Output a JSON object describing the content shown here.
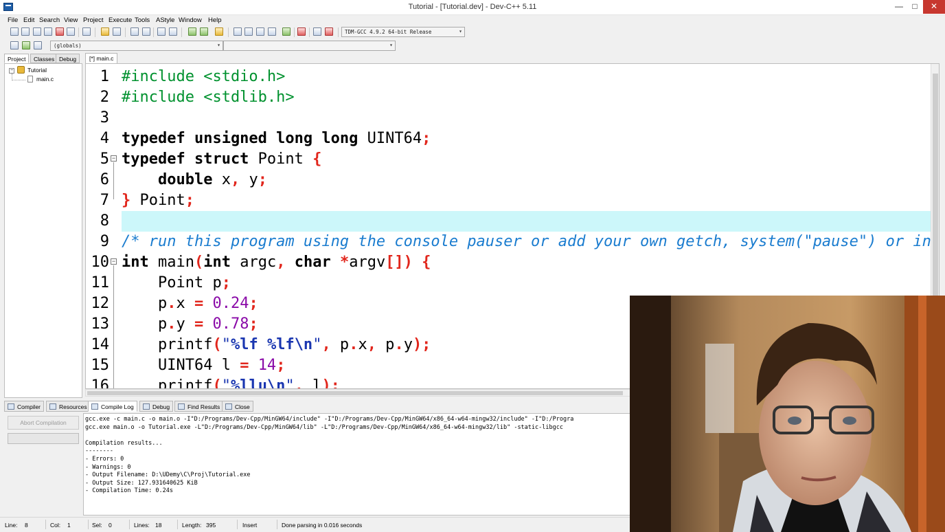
{
  "window": {
    "title": "Tutorial - [Tutorial.dev] - Dev-C++ 5.11",
    "minimize_glyph": "—",
    "maximize_glyph": "□",
    "close_glyph": "✕"
  },
  "menu": [
    "File",
    "Edit",
    "Search",
    "View",
    "Project",
    "Execute",
    "Tools",
    "AStyle",
    "Window",
    "Help"
  ],
  "toolbar": {
    "compiler_select": "TDM-GCC 4.9.2 64-bit Release",
    "scope_select": "(globals)",
    "symbol_select": ""
  },
  "left_panel": {
    "tabs": [
      "Project",
      "Classes",
      "Debug"
    ],
    "tree": {
      "project": "Tutorial",
      "file": "main.c"
    }
  },
  "editor": {
    "tab_label": "[*] main.c",
    "line_numbers": [
      "1",
      "2",
      "3",
      "4",
      "5",
      "6",
      "7",
      "8",
      "9",
      "10",
      "11",
      "12",
      "13",
      "14",
      "15",
      "16"
    ],
    "current_line": 8
  },
  "bottom_panel": {
    "tabs": [
      "Compiler",
      "Resources",
      "Compile Log",
      "Debug",
      "Find Results",
      "Close"
    ],
    "abort_label": "Abort Compilation",
    "log_lines": [
      "gcc.exe -c main.c -o main.o -I\"D:/Programs/Dev-Cpp/MinGW64/include\" -I\"D:/Programs/Dev-Cpp/MinGW64/x86_64-w64-mingw32/include\" -I\"D:/Progra",
      "gcc.exe main.o -o Tutorial.exe -L\"D:/Programs/Dev-Cpp/MinGW64/lib\" -L\"D:/Programs/Dev-Cpp/MinGW64/x86_64-w64-mingw32/lib\" -static-libgcc",
      "",
      "Compilation results...",
      "--------",
      "- Errors: 0",
      "- Warnings: 0",
      "- Output Filename: D:\\UDemy\\C\\Proj\\Tutorial.exe",
      "- Output Size: 127.931640625 KiB",
      "- Compilation Time: 0.24s"
    ]
  },
  "status": {
    "line_label": "Line:",
    "line": "8",
    "col_label": "Col:",
    "col": "1",
    "sel_label": "Sel:",
    "sel": "0",
    "lines_label": "Lines:",
    "lines": "18",
    "length_label": "Length:",
    "length": "395",
    "mode": "Insert",
    "message": "Done parsing in 0.016 seconds"
  },
  "colors": {
    "current_line": "#ccf7fa",
    "preprocessor": "#00912e",
    "operator": "#e1261c",
    "comment": "#1a7ccf",
    "number": "#8a0aa8",
    "string": "#1a36b0"
  }
}
